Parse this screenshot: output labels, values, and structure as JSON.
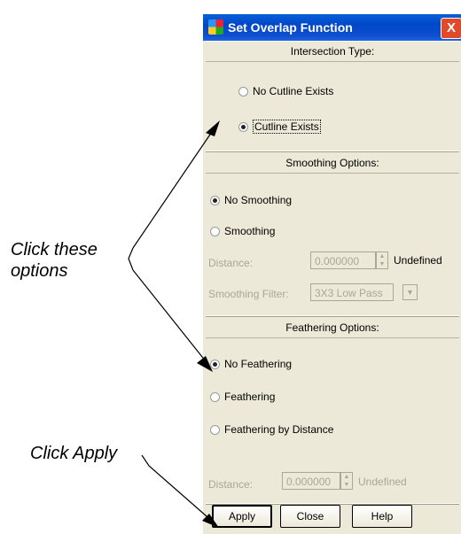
{
  "dialog": {
    "title": "Set Overlap Function",
    "close_glyph": "X",
    "intersection": {
      "header": "Intersection Type:",
      "options": [
        "No Cutline Exists",
        "Cutline Exists"
      ],
      "selected": 1
    },
    "smoothing": {
      "header": "Smoothing Options:",
      "options": [
        "No Smoothing",
        "Smoothing"
      ],
      "selected": 0,
      "distance_label": "Distance:",
      "distance_value": "0.000000",
      "distance_unit": "Undefined",
      "filter_label": "Smoothing Filter:",
      "filter_value": "3X3 Low Pass"
    },
    "feathering": {
      "header": "Feathering Options:",
      "options": [
        "No Feathering",
        "Feathering",
        "Feathering by Distance"
      ],
      "selected": 0,
      "distance_label": "Distance:",
      "distance_value": "0.000000",
      "distance_unit": "Undefined"
    },
    "buttons": {
      "apply": "Apply",
      "close": "Close",
      "help": "Help"
    }
  },
  "annotations": {
    "click_options": [
      "Click these",
      "options"
    ],
    "click_apply": "Click Apply"
  },
  "icons": [
    "app-icon",
    "close-icon",
    "radio-icon",
    "spinner-icon",
    "dropdown-arrow-icon"
  ]
}
